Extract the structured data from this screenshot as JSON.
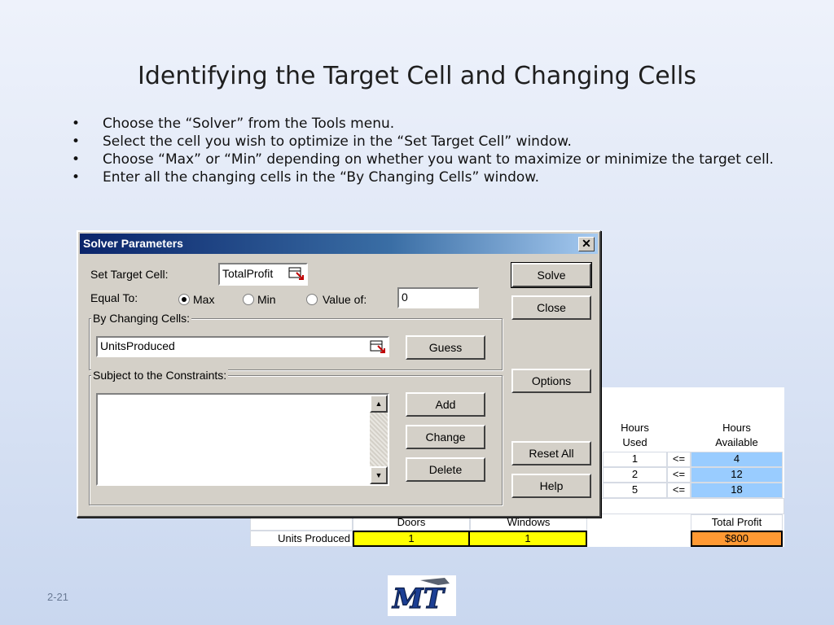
{
  "slide": {
    "title": "Identifying the Target Cell and Changing Cells",
    "bullets": [
      "Choose the “Solver” from the Tools menu.",
      "Select the cell you wish to optimize in the “Set Target Cell” window.",
      "Choose “Max” or “Min” depending on whether you want to maximize or minimize the target cell.",
      "Enter all the changing cells in the “By Changing Cells” window."
    ],
    "page_number": "2-21",
    "logo_text": "MT"
  },
  "dialog": {
    "title": "Solver Parameters",
    "close_glyph": "✕",
    "set_target_label": "Set Target Cell:",
    "target_value": "TotalProfit",
    "equal_to_label": "Equal To:",
    "opt_max": "Max",
    "opt_min": "Min",
    "opt_value_of": "Value of:",
    "selected_option": "Max",
    "value_of": "0",
    "changing_label": "By Changing Cells:",
    "changing_value": "UnitsProduced",
    "constraints_label": "Subject to the Constraints:",
    "buttons": {
      "solve": "Solve",
      "close": "Close",
      "options": "Options",
      "reset_all": "Reset All",
      "help": "Help",
      "guess": "Guess",
      "add": "Add",
      "change": "Change",
      "delete": "Delete"
    }
  },
  "sheet": {
    "hours_used_1": "Hours",
    "hours_used_2": "Used",
    "hours_avail_1": "Hours",
    "hours_avail_2": "Available",
    "rows": [
      {
        "used": "1",
        "op": "<=",
        "avail": "4"
      },
      {
        "used": "2",
        "op": "<=",
        "avail": "12"
      },
      {
        "used": "5",
        "op": "<=",
        "avail": "18"
      }
    ],
    "col_doors": "Doors",
    "col_windows": "Windows",
    "col_total_profit": "Total Profit",
    "row_label": "Units Produced",
    "doors_value": "1",
    "windows_value": "1",
    "total_profit_value": "$800",
    "colors": {
      "avail": "#99ccff",
      "units": "#ffff00",
      "profit": "#ff9933"
    }
  }
}
